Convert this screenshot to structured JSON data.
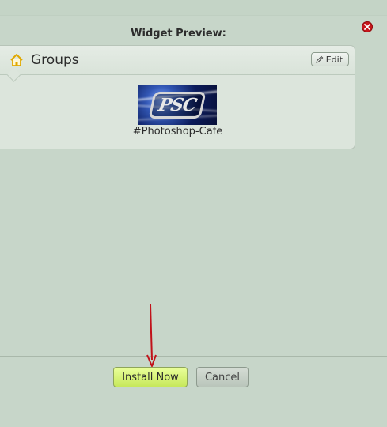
{
  "dialog": {
    "title": "Widget Preview:"
  },
  "widget": {
    "title": "Groups",
    "edit_label": "Edit",
    "group": {
      "name": "#Photoshop-Cafe",
      "image_text": "PSC"
    }
  },
  "buttons": {
    "install_label": "Install Now",
    "cancel_label": "Cancel"
  },
  "colors": {
    "background": "#c7d6c9",
    "install_button": "#c6e85a",
    "close_button": "#c7161b",
    "arrow": "#c1121a"
  },
  "icons": {
    "close": "close-icon",
    "home": "home-icon",
    "edit": "pencil-icon"
  }
}
